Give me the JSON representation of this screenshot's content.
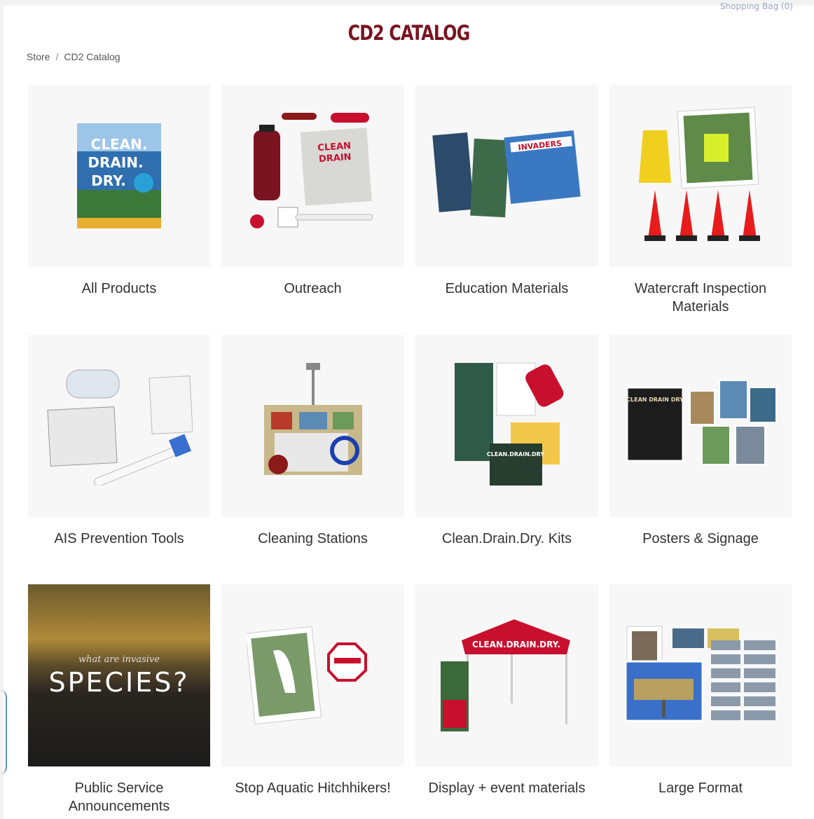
{
  "header": {
    "cart_label": "Shopping Bag (0)",
    "title": "CD2 CATALOG"
  },
  "breadcrumb": {
    "items": [
      "Store",
      "CD2 Catalog"
    ],
    "separator": "/"
  },
  "categories": [
    {
      "label": "All Products",
      "icon": "book-cover-icon"
    },
    {
      "label": "Outreach",
      "icon": "outreach-items-icon"
    },
    {
      "label": "Education Materials",
      "icon": "brochures-icon"
    },
    {
      "label": "Watercraft Inspection Materials",
      "icon": "cones-icon"
    },
    {
      "label": "AIS Prevention Tools",
      "icon": "tools-icon"
    },
    {
      "label": "Cleaning Stations",
      "icon": "cleaning-station-icon"
    },
    {
      "label": "Clean.Drain.Dry. Kits",
      "icon": "kit-icon"
    },
    {
      "label": "Posters & Signage",
      "icon": "posters-icon"
    },
    {
      "label": "Public Service Announcements",
      "icon": "video-thumbnail"
    },
    {
      "label": "Stop Aquatic Hitchhikers!",
      "icon": "flag-sign-icon"
    },
    {
      "label": "Display + event materials",
      "icon": "tent-icon"
    },
    {
      "label": "Large Format",
      "icon": "billboard-icon"
    }
  ],
  "psa_thumb": {
    "small": "what are invasive",
    "big": "SPECIES?"
  },
  "colors": {
    "title": "#7a1420",
    "accent_red": "#c8102e",
    "thumb_bg": "#f7f7f7"
  }
}
